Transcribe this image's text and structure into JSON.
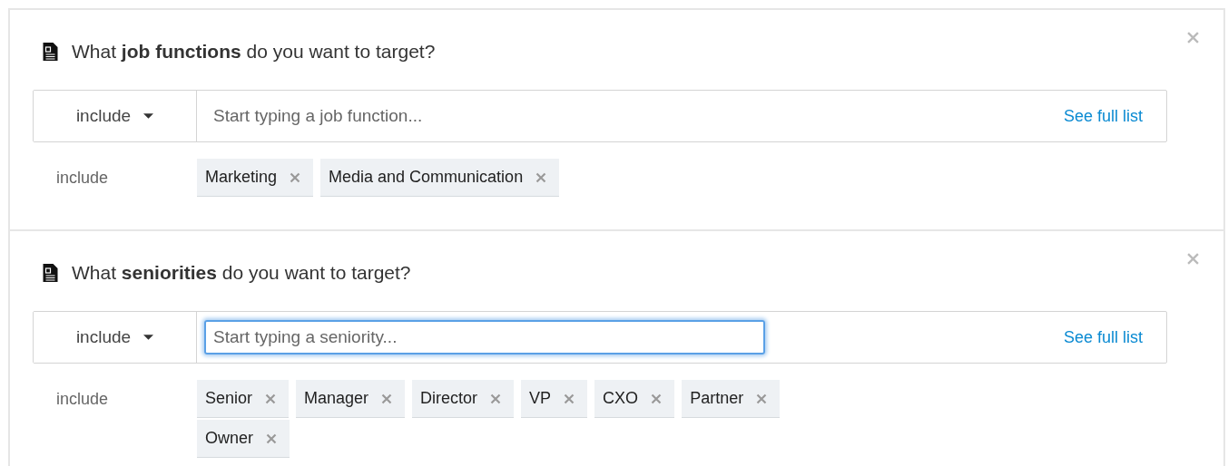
{
  "sections": [
    {
      "question": "What **job functions** do you want to target?",
      "mode": "include",
      "placeholder": "Start typing a job function...",
      "focused": false,
      "link": "See full list",
      "tags_label": "include",
      "tags": [
        "Marketing",
        "Media and Communication"
      ]
    },
    {
      "question": "What **seniorities** do you want to target?",
      "mode": "include",
      "placeholder": "Start typing a seniority...",
      "focused": true,
      "link": "See full list",
      "tags_label": "include",
      "tags": [
        "Senior",
        "Manager",
        "Director",
        "VP",
        "CXO",
        "Partner",
        "Owner"
      ]
    }
  ]
}
